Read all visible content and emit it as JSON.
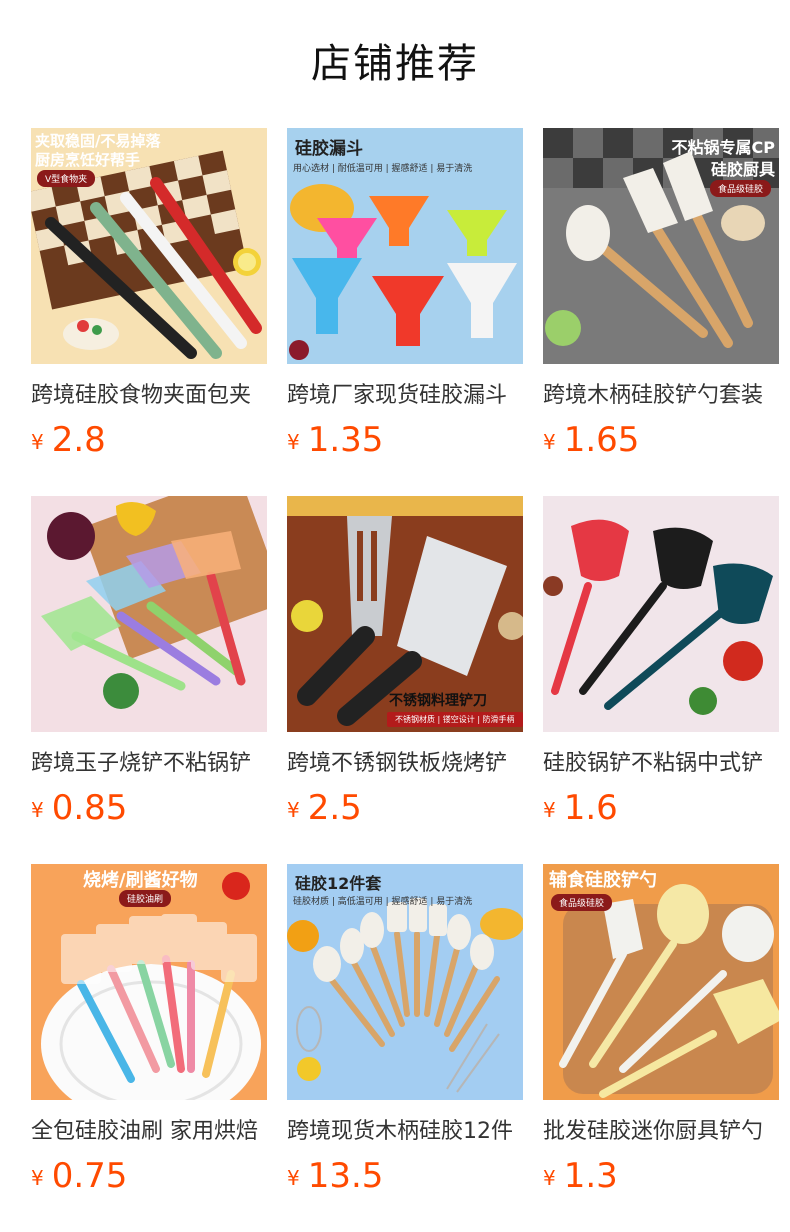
{
  "header": {
    "title": "店铺推荐"
  },
  "currency": "¥",
  "products": [
    {
      "title": "跨境硅胶食物夹面包夹",
      "price": "2.8",
      "img": {
        "line1": "夹取稳固/不易掉落",
        "line2": "厨房烹饪好帮手",
        "badge": "V型食物夹"
      }
    },
    {
      "title": "跨境厂家现货硅胶漏斗",
      "price": "1.35",
      "img": {
        "line1": "硅胶漏斗",
        "sub": "用心选材 | 耐低温可用 | 握感舒适 | 易于清洗"
      }
    },
    {
      "title": "跨境木柄硅胶铲勺套装",
      "price": "1.65",
      "img": {
        "line1": "不粘锅专属CP",
        "line2": "硅胶厨具",
        "badge": "食品级硅胶"
      }
    },
    {
      "title": "跨境玉子烧铲不粘锅铲",
      "price": "0.85",
      "img": {}
    },
    {
      "title": "跨境不锈钢铁板烧烤铲",
      "price": "2.5",
      "img": {
        "line1": "不锈钢料理铲刀",
        "badge": "不锈钢材质 | 镂空设计 | 防滑手柄"
      }
    },
    {
      "title": "硅胶锅铲不粘锅中式铲",
      "price": "1.6",
      "img": {}
    },
    {
      "title": "全包硅胶油刷 家用烘焙",
      "price": "0.75",
      "img": {
        "line1": "烧烤/刷酱好物",
        "badge": "硅胶油刷"
      }
    },
    {
      "title": "跨境现货木柄硅胶12件",
      "price": "13.5",
      "img": {
        "line1": "硅胶12件套",
        "sub": "硅胶材质 | 高低温可用 | 握感舒适 | 易于清洗"
      }
    },
    {
      "title": "批发硅胶迷你厨具铲勺",
      "price": "1.3",
      "img": {
        "line1": "辅食硅胶铲勺",
        "badge": "食品级硅胶"
      }
    }
  ],
  "colors": {
    "price": "#ff4a00",
    "title": "#333333"
  }
}
